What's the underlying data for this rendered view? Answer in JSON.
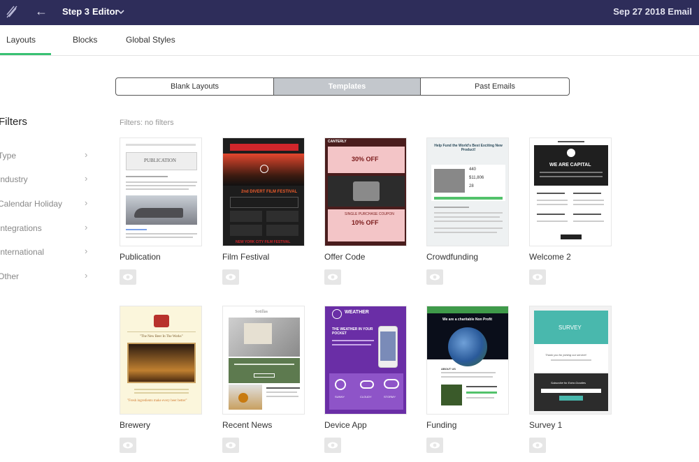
{
  "header": {
    "step_label": "Step 3",
    "step_name": "Editor",
    "email_title": "Sep 27 2018 Email"
  },
  "tabs": [
    {
      "label": "Layouts",
      "active": true
    },
    {
      "label": "Blocks",
      "active": false
    },
    {
      "label": "Global Styles",
      "active": false
    }
  ],
  "layout_source": {
    "options": [
      "Blank Layouts",
      "Templates",
      "Past Emails"
    ],
    "selected": "Templates"
  },
  "filters": {
    "title": "Filters",
    "status": "Filters: no filters",
    "items": [
      "Type",
      "Industry",
      "Calendar Holiday",
      "Integrations",
      "International",
      "Other"
    ]
  },
  "templates": [
    {
      "name": "Publication",
      "thumb": {
        "header": "PUBLICATION"
      }
    },
    {
      "name": "Film Festival",
      "thumb": {
        "header": "2nd DIVERT FILM FESTIVAL",
        "footer": "NEW YORK CITY FILM FESTIVAL"
      }
    },
    {
      "name": "Offer Code",
      "thumb": {
        "brand": "CANTERLY",
        "offer1": "30% OFF",
        "offer2": "10% OFF",
        "coupon": "SINGLE PURCHASE COUPON"
      }
    },
    {
      "name": "Crowdfunding",
      "thumb": {
        "title": "Help Fund the World's Best Exciting New Product!",
        "stats": [
          "440",
          "$11,806",
          "28"
        ]
      }
    },
    {
      "name": "Welcome 2",
      "thumb": {
        "title": "WE ARE CAPITAL"
      }
    },
    {
      "name": "Brewery",
      "thumb": {
        "quote": "\"The New Beer In The Works\"",
        "tagline": "\"Fresh ingredients make every beer better\""
      }
    },
    {
      "name": "Recent News",
      "thumb": {
        "brand": "Sotillas"
      }
    },
    {
      "name": "Device App",
      "thumb": {
        "brand": "WEATHER",
        "headline": "THE WEATHER IN YOUR POCKET",
        "days": [
          "SUNNY",
          "CLOUDY",
          "STORMY"
        ]
      }
    },
    {
      "name": "Funding",
      "thumb": {
        "headline": "We are a charitable Non Profit",
        "section": "ABOUT US"
      }
    },
    {
      "name": "Survey 1",
      "thumb": {
        "title": "SURVEY",
        "thanks": "Thank you for joining our service!",
        "subscribe": "Subscribe for Extra Goodies"
      }
    }
  ],
  "colors": {
    "topbar": "#2e2d5a",
    "active_tab_underline": "#38c173",
    "segment_active": "#c3c7cc"
  },
  "icons": {
    "logo": "feather-logo-icon",
    "back": "arrow-left-icon",
    "step_menu": "chevron-down-icon",
    "filter_expand": "chevron-right-icon",
    "preview": "eye-icon"
  }
}
